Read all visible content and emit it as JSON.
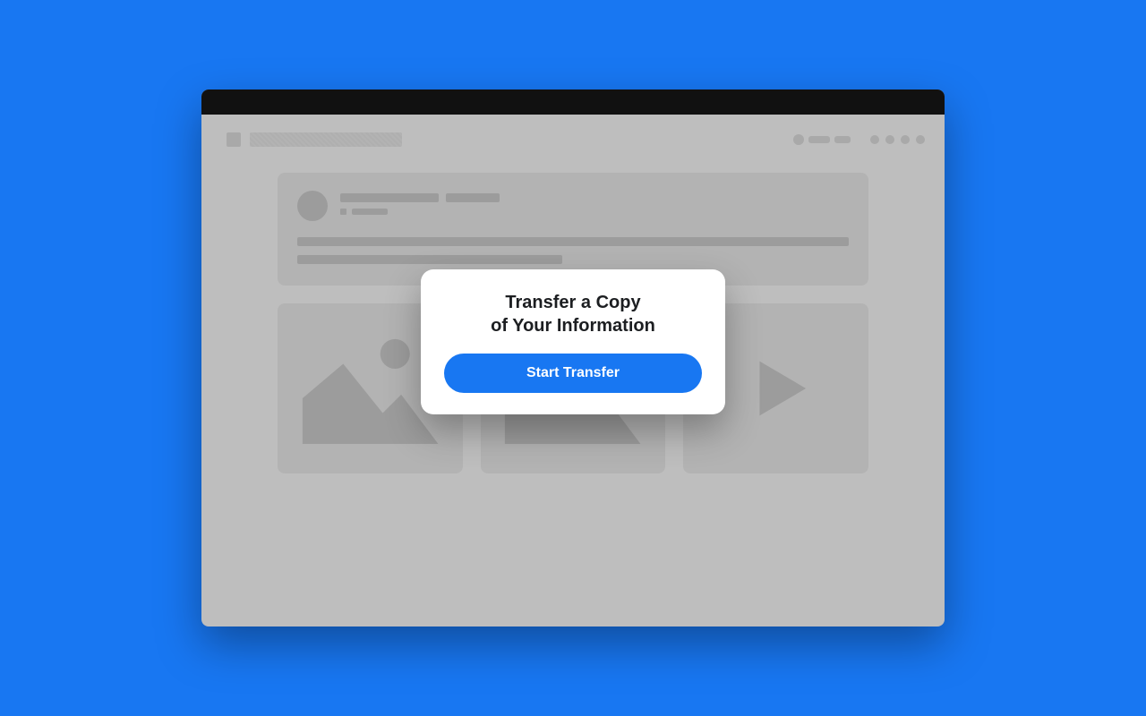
{
  "modal": {
    "title": "Transfer a Copy\nof Your Information",
    "button_label": "Start Transfer"
  },
  "colors": {
    "page_bg": "#1877F2",
    "modal_bg": "#FFFFFF",
    "button_bg": "#1877F2",
    "button_text": "#FFFFFF",
    "wireframe_panel": "#BEBEBE",
    "wireframe_shape": "#9C9C9C"
  }
}
